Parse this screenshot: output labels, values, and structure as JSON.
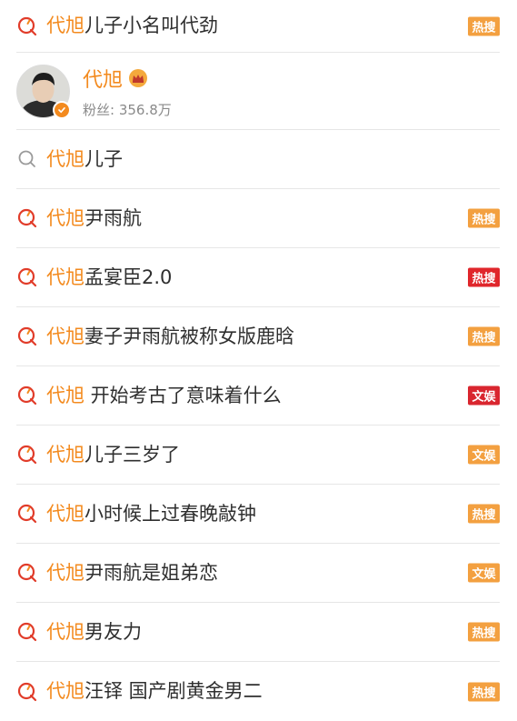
{
  "colors": {
    "highlight": "#f38a1e",
    "badge_hot": "#f3a040",
    "badge_hot_red": "#e0262b",
    "badge_ent_red": "#d9262f",
    "badge_ent_orange": "#f3a040"
  },
  "rows": [
    {
      "hl": "代旭",
      "rest": "儿子小名叫代劲",
      "badge": "热搜",
      "badge_color": "#f3a040",
      "icon": "search-q-icon"
    },
    {
      "hl": "代旭",
      "rest": "儿子",
      "badge": "",
      "icon": "search-plain-icon"
    },
    {
      "hl": "代旭",
      "rest": "尹雨航",
      "badge": "热搜",
      "badge_color": "#f3a040",
      "icon": "search-q-icon"
    },
    {
      "hl": "代旭",
      "rest": "孟宴臣2.0",
      "badge": "热搜",
      "badge_color": "#e0262b",
      "icon": "search-q-icon"
    },
    {
      "hl": "代旭",
      "rest": "妻子尹雨航被称女版鹿晗",
      "badge": "热搜",
      "badge_color": "#f3a040",
      "icon": "search-q-icon"
    },
    {
      "hl": "代旭",
      "rest": " 开始考古了意味着什么",
      "badge": "文娱",
      "badge_color": "#d9262f",
      "icon": "search-q-icon"
    },
    {
      "hl": "代旭",
      "rest": "儿子三岁了",
      "badge": "文娱",
      "badge_color": "#f3a040",
      "icon": "search-q-icon"
    },
    {
      "hl": "代旭",
      "rest": "小时候上过春晚敲钟",
      "badge": "热搜",
      "badge_color": "#f3a040",
      "icon": "search-q-icon"
    },
    {
      "hl": "代旭",
      "rest": "尹雨航是姐弟恋",
      "badge": "文娱",
      "badge_color": "#f3a040",
      "icon": "search-q-icon"
    },
    {
      "hl": "代旭",
      "rest": "男友力",
      "badge": "热搜",
      "badge_color": "#f3a040",
      "icon": "search-q-icon"
    },
    {
      "hl": "代旭",
      "rest": "汪铎 国产剧黄金男二",
      "badge": "热搜",
      "badge_color": "#f3a040",
      "icon": "search-q-icon"
    }
  ],
  "user": {
    "name": "代旭",
    "fans": "粉丝: 356.8万",
    "avatar_icon": "avatar",
    "crown_icon": "crown-icon",
    "verified_icon": "verified-icon"
  }
}
